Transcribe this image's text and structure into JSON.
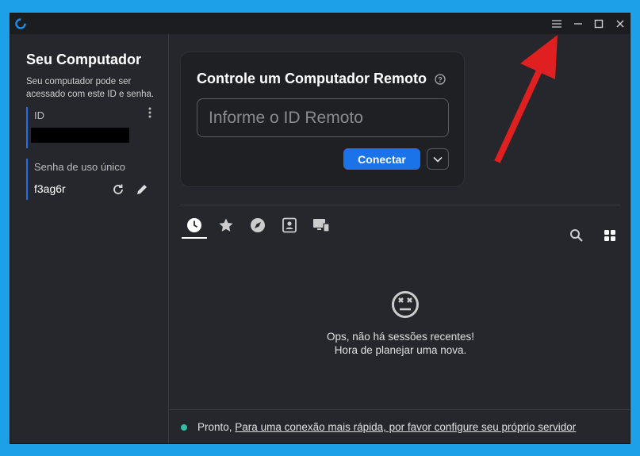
{
  "window": {
    "controls": {
      "menu_icon": "hamburger-menu-icon",
      "minimize_icon": "minimize-icon",
      "maximize_icon": "maximize-icon",
      "close_icon": "close-icon"
    }
  },
  "sidebar": {
    "title": "Seu Computador",
    "description": "Seu computador pode ser acessado com este ID e senha.",
    "id_label": "ID",
    "id_value": "",
    "password_label": "Senha de uso único",
    "password_value": "f3ag6r"
  },
  "remote": {
    "title": "Controle um Computador Remoto",
    "input_placeholder": "Informe o ID Remoto",
    "input_value": "",
    "connect_label": "Conectar"
  },
  "tabs": [
    {
      "icon": "clock-icon",
      "active": true
    },
    {
      "icon": "star-icon",
      "active": false
    },
    {
      "icon": "compass-icon",
      "active": false
    },
    {
      "icon": "address-book-icon",
      "active": false
    },
    {
      "icon": "devices-icon",
      "active": false
    }
  ],
  "empty_state": {
    "line1": "Ops, não há sessões recentes!",
    "line2": "Hora de planejar uma nova."
  },
  "status": {
    "ready": "Pronto,",
    "link": "Para uma conexão mais rápida, por favor configure seu próprio servidor"
  },
  "colors": {
    "accent": "#1a73e8",
    "status_ok": "#32bea6",
    "annotation_arrow": "#e02020",
    "background": "#1ea0e8"
  }
}
